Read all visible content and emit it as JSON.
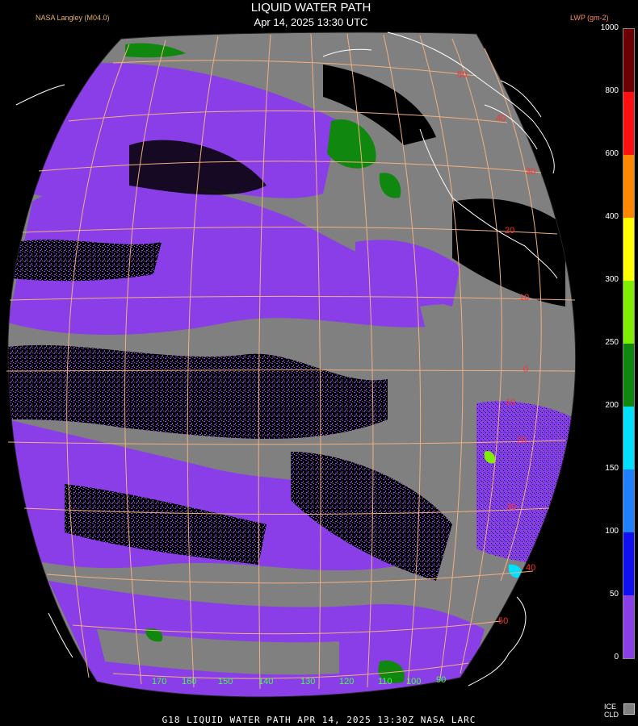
{
  "header": {
    "title": "LIQUID WATER PATH",
    "subtitle": "Apr 14, 2025 13:30 UTC",
    "producer": "NASA Langley (M04.0)",
    "unit_label": "LWP (gm-2)"
  },
  "footer": {
    "text": "G18  LIQUID WATER PATH   APR 14, 2025 13:30Z   NASA LARC"
  },
  "colorbar": {
    "ticks": [
      "1000",
      "800",
      "600",
      "400",
      "300",
      "250",
      "200",
      "150",
      "100",
      "50",
      "0"
    ],
    "segments": [
      {
        "from": 0,
        "to": 50,
        "color": "#8a3ee8"
      },
      {
        "from": 50,
        "to": 100,
        "color": "#1010f0"
      },
      {
        "from": 100,
        "to": 150,
        "color": "#1e7fff"
      },
      {
        "from": 150,
        "to": 200,
        "color": "#00e0ff"
      },
      {
        "from": 200,
        "to": 250,
        "color": "#108810"
      },
      {
        "from": 250,
        "to": 300,
        "color": "#80ee00"
      },
      {
        "from": 300,
        "to": 400,
        "color": "#ffff00"
      },
      {
        "from": 400,
        "to": 600,
        "color": "#ff8800"
      },
      {
        "from": 600,
        "to": 800,
        "color": "#ff1010"
      },
      {
        "from": 800,
        "to": 1000,
        "color": "#6a0000"
      }
    ],
    "ice_label_1": "ICE",
    "ice_label_2": "CLD",
    "ice_color": "#808080"
  },
  "map": {
    "lat_labels": [
      "50",
      "40",
      "30",
      "20",
      "10",
      "0",
      "10",
      "20",
      "30",
      "40",
      "50"
    ],
    "lon_labels": [
      "170",
      "160",
      "150",
      "140",
      "130",
      "120",
      "110",
      "100",
      "90"
    ],
    "grid_color": "#f0b080",
    "lat_label_color": "#ff3030",
    "lon_label_color": "#40ff40",
    "cloud_gray": "#808080",
    "clear_black": "#000000"
  }
}
